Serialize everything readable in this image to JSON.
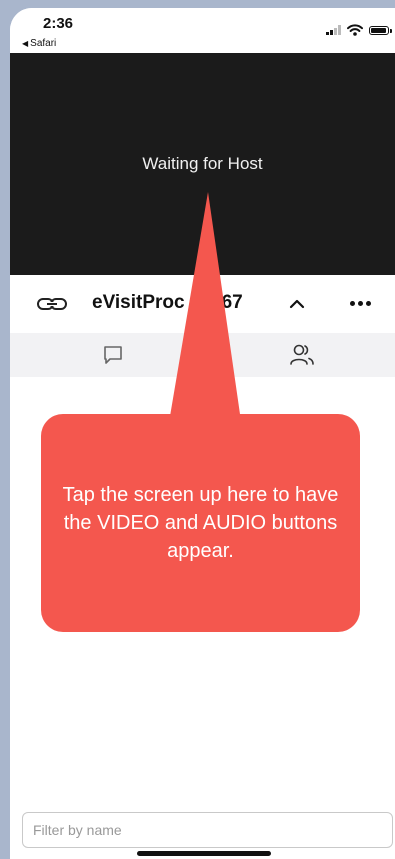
{
  "status_bar": {
    "time": "2:36",
    "back_app": "Safari",
    "back_icon": "back-triangle-icon",
    "icons": [
      "signal-icon",
      "wifi-icon",
      "battery-icon"
    ]
  },
  "video": {
    "waiting_text": "Waiting for Host"
  },
  "meeting_bar": {
    "link_icon": "link-icon",
    "meeting_name": "eVisitProc 45767",
    "collapse_icon": "chevron-up-icon",
    "more_icon": "more-horizontal-icon"
  },
  "tabs": [
    {
      "name": "chat",
      "icon": "chat-bubble-icon"
    },
    {
      "name": "participants",
      "icon": "people-icon"
    }
  ],
  "annotation": {
    "text": "Tap the screen up here to have the VIDEO and AUDIO buttons appear.",
    "color": "#f4574e"
  },
  "filter": {
    "placeholder": "Filter by name",
    "value": ""
  },
  "colors": {
    "video_bg": "#1b1b1b",
    "tab_bar_bg": "#f2f2f4",
    "page_frame_bg": "#a9b6cc"
  }
}
